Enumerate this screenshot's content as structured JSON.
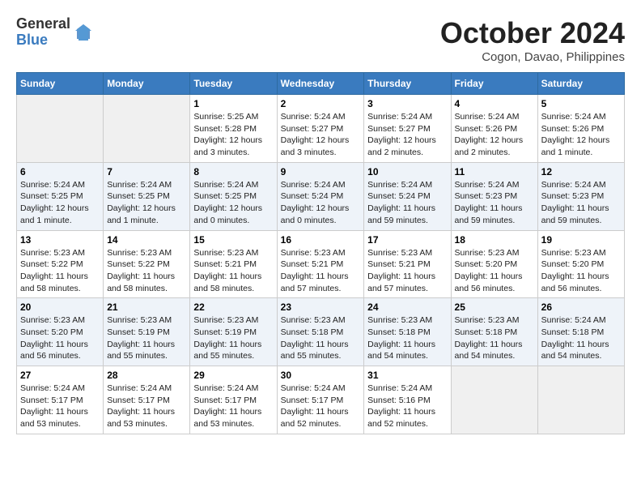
{
  "header": {
    "logo_general": "General",
    "logo_blue": "Blue",
    "month_title": "October 2024",
    "location": "Cogon, Davao, Philippines"
  },
  "weekdays": [
    "Sunday",
    "Monday",
    "Tuesday",
    "Wednesday",
    "Thursday",
    "Friday",
    "Saturday"
  ],
  "weeks": [
    [
      {
        "day": "",
        "info": ""
      },
      {
        "day": "",
        "info": ""
      },
      {
        "day": "1",
        "info": "Sunrise: 5:25 AM\nSunset: 5:28 PM\nDaylight: 12 hours and 3 minutes."
      },
      {
        "day": "2",
        "info": "Sunrise: 5:24 AM\nSunset: 5:27 PM\nDaylight: 12 hours and 3 minutes."
      },
      {
        "day": "3",
        "info": "Sunrise: 5:24 AM\nSunset: 5:27 PM\nDaylight: 12 hours and 2 minutes."
      },
      {
        "day": "4",
        "info": "Sunrise: 5:24 AM\nSunset: 5:26 PM\nDaylight: 12 hours and 2 minutes."
      },
      {
        "day": "5",
        "info": "Sunrise: 5:24 AM\nSunset: 5:26 PM\nDaylight: 12 hours and 1 minute."
      }
    ],
    [
      {
        "day": "6",
        "info": "Sunrise: 5:24 AM\nSunset: 5:25 PM\nDaylight: 12 hours and 1 minute."
      },
      {
        "day": "7",
        "info": "Sunrise: 5:24 AM\nSunset: 5:25 PM\nDaylight: 12 hours and 1 minute."
      },
      {
        "day": "8",
        "info": "Sunrise: 5:24 AM\nSunset: 5:25 PM\nDaylight: 12 hours and 0 minutes."
      },
      {
        "day": "9",
        "info": "Sunrise: 5:24 AM\nSunset: 5:24 PM\nDaylight: 12 hours and 0 minutes."
      },
      {
        "day": "10",
        "info": "Sunrise: 5:24 AM\nSunset: 5:24 PM\nDaylight: 11 hours and 59 minutes."
      },
      {
        "day": "11",
        "info": "Sunrise: 5:24 AM\nSunset: 5:23 PM\nDaylight: 11 hours and 59 minutes."
      },
      {
        "day": "12",
        "info": "Sunrise: 5:24 AM\nSunset: 5:23 PM\nDaylight: 11 hours and 59 minutes."
      }
    ],
    [
      {
        "day": "13",
        "info": "Sunrise: 5:23 AM\nSunset: 5:22 PM\nDaylight: 11 hours and 58 minutes."
      },
      {
        "day": "14",
        "info": "Sunrise: 5:23 AM\nSunset: 5:22 PM\nDaylight: 11 hours and 58 minutes."
      },
      {
        "day": "15",
        "info": "Sunrise: 5:23 AM\nSunset: 5:21 PM\nDaylight: 11 hours and 58 minutes."
      },
      {
        "day": "16",
        "info": "Sunrise: 5:23 AM\nSunset: 5:21 PM\nDaylight: 11 hours and 57 minutes."
      },
      {
        "day": "17",
        "info": "Sunrise: 5:23 AM\nSunset: 5:21 PM\nDaylight: 11 hours and 57 minutes."
      },
      {
        "day": "18",
        "info": "Sunrise: 5:23 AM\nSunset: 5:20 PM\nDaylight: 11 hours and 56 minutes."
      },
      {
        "day": "19",
        "info": "Sunrise: 5:23 AM\nSunset: 5:20 PM\nDaylight: 11 hours and 56 minutes."
      }
    ],
    [
      {
        "day": "20",
        "info": "Sunrise: 5:23 AM\nSunset: 5:20 PM\nDaylight: 11 hours and 56 minutes."
      },
      {
        "day": "21",
        "info": "Sunrise: 5:23 AM\nSunset: 5:19 PM\nDaylight: 11 hours and 55 minutes."
      },
      {
        "day": "22",
        "info": "Sunrise: 5:23 AM\nSunset: 5:19 PM\nDaylight: 11 hours and 55 minutes."
      },
      {
        "day": "23",
        "info": "Sunrise: 5:23 AM\nSunset: 5:18 PM\nDaylight: 11 hours and 55 minutes."
      },
      {
        "day": "24",
        "info": "Sunrise: 5:23 AM\nSunset: 5:18 PM\nDaylight: 11 hours and 54 minutes."
      },
      {
        "day": "25",
        "info": "Sunrise: 5:23 AM\nSunset: 5:18 PM\nDaylight: 11 hours and 54 minutes."
      },
      {
        "day": "26",
        "info": "Sunrise: 5:24 AM\nSunset: 5:18 PM\nDaylight: 11 hours and 54 minutes."
      }
    ],
    [
      {
        "day": "27",
        "info": "Sunrise: 5:24 AM\nSunset: 5:17 PM\nDaylight: 11 hours and 53 minutes."
      },
      {
        "day": "28",
        "info": "Sunrise: 5:24 AM\nSunset: 5:17 PM\nDaylight: 11 hours and 53 minutes."
      },
      {
        "day": "29",
        "info": "Sunrise: 5:24 AM\nSunset: 5:17 PM\nDaylight: 11 hours and 53 minutes."
      },
      {
        "day": "30",
        "info": "Sunrise: 5:24 AM\nSunset: 5:17 PM\nDaylight: 11 hours and 52 minutes."
      },
      {
        "day": "31",
        "info": "Sunrise: 5:24 AM\nSunset: 5:16 PM\nDaylight: 11 hours and 52 minutes."
      },
      {
        "day": "",
        "info": ""
      },
      {
        "day": "",
        "info": ""
      }
    ]
  ]
}
